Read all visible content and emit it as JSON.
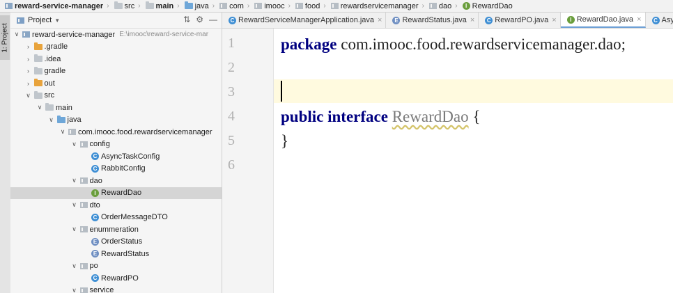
{
  "breadcrumb": [
    {
      "label": "reward-service-manager",
      "icon": "module-icon",
      "bold": true
    },
    {
      "label": "src",
      "icon": "folder-icon",
      "bold": false
    },
    {
      "label": "main",
      "icon": "folder-icon",
      "bold": true
    },
    {
      "label": "java",
      "icon": "source-folder-icon",
      "bold": false
    },
    {
      "label": "com",
      "icon": "package-icon",
      "bold": false
    },
    {
      "label": "imooc",
      "icon": "package-icon",
      "bold": false
    },
    {
      "label": "food",
      "icon": "package-icon",
      "bold": false
    },
    {
      "label": "rewardservicemanager",
      "icon": "package-icon",
      "bold": false
    },
    {
      "label": "dao",
      "icon": "package-icon",
      "bold": false
    },
    {
      "label": "RewardDao",
      "icon": "interface-icon",
      "bold": false
    }
  ],
  "tool_window": {
    "label": "1: Project"
  },
  "project_panel": {
    "title": "Project",
    "tree": [
      {
        "label": "reward-service-manager",
        "path": "E:\\imooc\\reward-service-mar",
        "depth": 0,
        "arrow": "down",
        "icon": "module"
      },
      {
        "label": ".gradle",
        "depth": 1,
        "arrow": "right",
        "icon": "folder-orange"
      },
      {
        "label": ".idea",
        "depth": 1,
        "arrow": "right",
        "icon": "folder"
      },
      {
        "label": "gradle",
        "depth": 1,
        "arrow": "right",
        "icon": "folder"
      },
      {
        "label": "out",
        "depth": 1,
        "arrow": "right",
        "icon": "folder-orange"
      },
      {
        "label": "src",
        "depth": 1,
        "arrow": "down",
        "icon": "folder"
      },
      {
        "label": "main",
        "depth": 2,
        "arrow": "down",
        "icon": "folder"
      },
      {
        "label": "java",
        "depth": 3,
        "arrow": "down",
        "icon": "folder-blue"
      },
      {
        "label": "com.imooc.food.rewardservicemanager",
        "depth": 4,
        "arrow": "down",
        "icon": "package"
      },
      {
        "label": "config",
        "depth": 5,
        "arrow": "down",
        "icon": "package"
      },
      {
        "label": "AsyncTaskConfig",
        "depth": 6,
        "arrow": "",
        "icon": "class"
      },
      {
        "label": "RabbitConfig",
        "depth": 6,
        "arrow": "",
        "icon": "class"
      },
      {
        "label": "dao",
        "depth": 5,
        "arrow": "down",
        "icon": "package"
      },
      {
        "label": "RewardDao",
        "depth": 6,
        "arrow": "",
        "icon": "interface",
        "selected": true
      },
      {
        "label": "dto",
        "depth": 5,
        "arrow": "down",
        "icon": "package"
      },
      {
        "label": "OrderMessageDTO",
        "depth": 6,
        "arrow": "",
        "icon": "class"
      },
      {
        "label": "enummeration",
        "depth": 5,
        "arrow": "down",
        "icon": "package"
      },
      {
        "label": "OrderStatus",
        "depth": 6,
        "arrow": "",
        "icon": "enum"
      },
      {
        "label": "RewardStatus",
        "depth": 6,
        "arrow": "",
        "icon": "enum"
      },
      {
        "label": "po",
        "depth": 5,
        "arrow": "down",
        "icon": "package"
      },
      {
        "label": "RewardPO",
        "depth": 6,
        "arrow": "",
        "icon": "class"
      },
      {
        "label": "service",
        "depth": 5,
        "arrow": "down",
        "icon": "package"
      }
    ]
  },
  "tabs": [
    {
      "label": "RewardServiceManagerApplication.java",
      "icon": "class",
      "active": false
    },
    {
      "label": "RewardStatus.java",
      "icon": "enum",
      "active": false
    },
    {
      "label": "RewardPO.java",
      "icon": "class",
      "active": false
    },
    {
      "label": "RewardDao.java",
      "icon": "interface",
      "active": true
    },
    {
      "label": "AsyncT",
      "icon": "class",
      "active": false
    }
  ],
  "editor": {
    "line_numbers": [
      "1",
      "2",
      "3",
      "4",
      "5",
      "6"
    ],
    "line1": {
      "keyword": "package",
      "rest": " com.imooc.food.rewardservicemanager.dao;"
    },
    "line4": {
      "kw1": "public",
      "kw2": "interface",
      "name": "RewardDao",
      "brace": " {"
    },
    "line5": {
      "brace": "}"
    }
  },
  "colors": {
    "keyword": "#000080",
    "unused_identifier": "#7a7a7a",
    "caret_line": "#fffadf"
  }
}
